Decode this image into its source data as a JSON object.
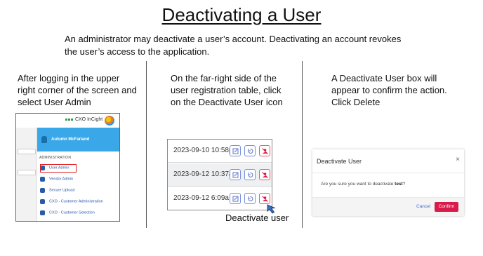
{
  "title": "Deactivating a User",
  "intro": "An administrator may deactivate a user’s account. Deactivating an account revokes the user’s access to the application.",
  "steps": [
    {
      "lines": [
        "After logging in the upper",
        "right corner of the screen and",
        "select User Admin"
      ]
    },
    {
      "lines": [
        "On the far-right side of the",
        "user registration table, click",
        "on the Deactivate User icon"
      ]
    },
    {
      "lines": [
        "A Deactivate User box will",
        "appear to confirm the action.",
        "Click Delete"
      ]
    }
  ],
  "menu_screenshot": {
    "logo_text": "CXO InCight",
    "user_name": "Autumn McFarland",
    "section_label": "ADMINISTRATION",
    "items": [
      {
        "label": "User Admin",
        "icon": "users-icon"
      },
      {
        "label": "Vendor Admin",
        "icon": "list-icon"
      },
      {
        "label": "Secure Upload",
        "icon": "cloud-upload-icon"
      },
      {
        "label": "CXO - Customer Administration",
        "icon": "person-lock-icon"
      },
      {
        "label": "CXO - Customer Selection",
        "icon": "trophy-icon"
      }
    ],
    "highlight_color": "#e02020",
    "header_color": "#3aa8e8"
  },
  "table_screenshot": {
    "rows": [
      {
        "date": "2023-09-10 10:58p"
      },
      {
        "date": "2023-09-12 10:37a"
      },
      {
        "date": "2023-09-12 6:09a"
      }
    ],
    "action_icons": [
      "edit-icon",
      "reset-icon",
      "deactivate-user-icon"
    ],
    "callout": "Deactivate user"
  },
  "dialog_screenshot": {
    "title": "Deactivate User",
    "close": "×",
    "message_prefix": "Are you sure you want to deactivate ",
    "message_user": "test",
    "message_suffix": "?",
    "cancel_label": "Cancel",
    "confirm_label": "Confirm",
    "confirm_color": "#d81b4a"
  }
}
